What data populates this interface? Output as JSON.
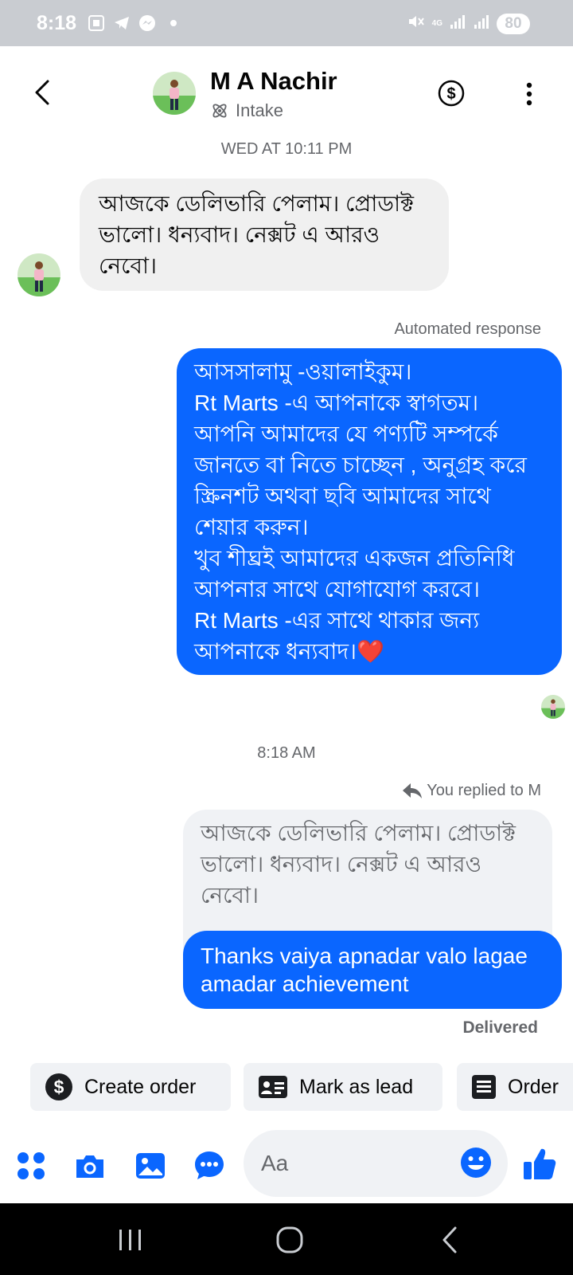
{
  "status_bar": {
    "time": "8:18",
    "network": "4G",
    "battery": "80",
    "icons": [
      "screenshot-icon",
      "telegram-icon",
      "messenger-icon",
      "notification-dot",
      "mute-icon",
      "signal-icon",
      "signal-icon"
    ]
  },
  "header": {
    "contact_name": "M A Nachir",
    "label": "Intake",
    "icons": [
      "back-icon",
      "avatar",
      "intake-icon",
      "dollar-icon",
      "more-icon"
    ]
  },
  "messages": [
    {
      "type": "timestamp",
      "text": "WED AT 10:11 PM"
    },
    {
      "type": "incoming",
      "text": "আজকে ডেলিভারি পেলাম। প্রোডাক্ট ভালো। ধন্যবাদ। নেক্সট এ আরও নেবো।"
    },
    {
      "type": "meta",
      "text": "Automated response"
    },
    {
      "type": "outgoing",
      "lines": [
        "আসসালামু -ওয়ালাইকুম।",
        "Rt Marts -এ আপনাকে স্বাগতম।",
        "আপনি আমাদের যে পণ্যটি সম্পর্কে",
        "জানতে বা নিতে চাচ্ছেন , অনুগ্রহ করে",
        "স্ক্রিনশট অথবা ছবি আমাদের সাথে",
        "শেয়ার করুন।",
        "খুব শীঘ্রই আমাদের একজন প্রতিনিধি",
        "আপনার সাথে যোগাযোগ করবে।",
        "Rt Marts -এর সাথে থাকার জন্য",
        "আপনাকে ধন্যবাদ।❤️"
      ]
    },
    {
      "type": "timestamp",
      "text": "8:18 AM"
    },
    {
      "type": "reply_label",
      "text": "You replied to M"
    },
    {
      "type": "quoted",
      "text": "আজকে ডেলিভারি পেলাম। প্রোডাক্ট ভালো। ধন্যবাদ। নেক্সট এ আরও নেবো।"
    },
    {
      "type": "outgoing",
      "text": "Thanks vaiya apnadar valo lagae amadar achievement"
    },
    {
      "type": "status",
      "text": "Delivered"
    }
  ],
  "quick_actions": [
    {
      "label": "Create order",
      "icon": "dollar-icon"
    },
    {
      "label": "Mark as lead",
      "icon": "contact-card-icon"
    },
    {
      "label": "Order",
      "icon": "list-icon"
    }
  ],
  "composer": {
    "placeholder": "Aa",
    "icons": [
      "apps-icon",
      "camera-icon",
      "gallery-icon",
      "chat-icon",
      "emoji-icon",
      "like-icon"
    ]
  },
  "colors": {
    "accent": "#0A66FF",
    "incoming_bubble": "#F0F0F0",
    "status_bar": "#C9CCD1",
    "secondary_text": "#65676B"
  }
}
